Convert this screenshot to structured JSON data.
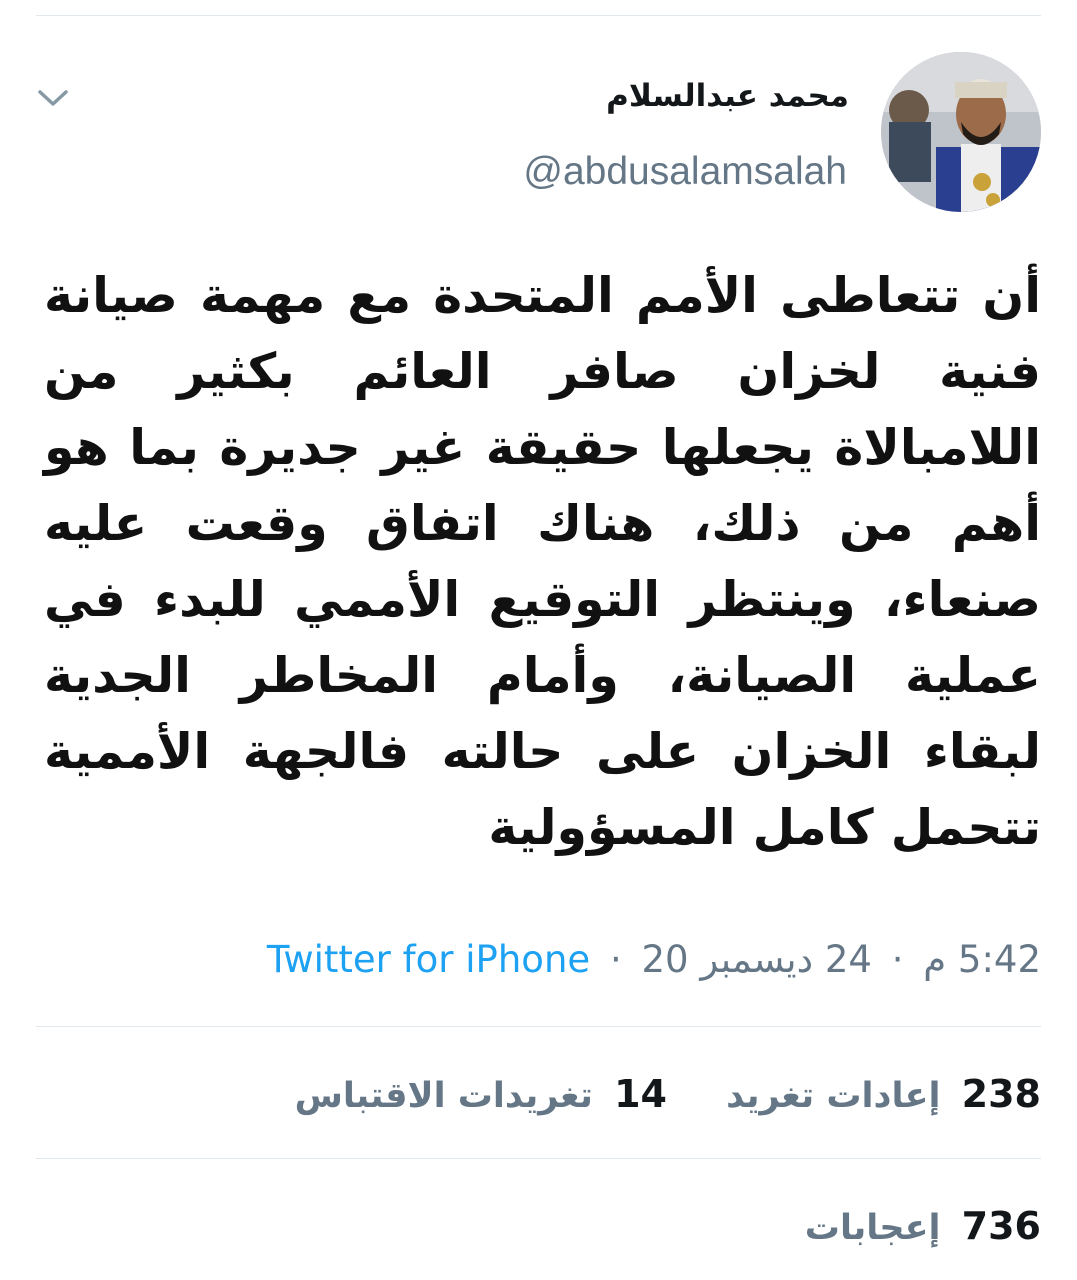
{
  "user": {
    "display_name": "محمد عبدالسلام",
    "handle": "@abdusalamsalah"
  },
  "tweet": {
    "text": "أن تتعاطى الأمم المتحدة مع مهمة صيانة فنية لخزان صافر العائم بكثير من اللامبالاة يجعلها حقيقة غير جديرة بما هو أهم من ذلك، هناك اتفاق وقعت عليه صنعاء، وينتظر التوقيع الأممي للبدء في عملية الصيانة، وأمام المخاطر الجدية لبقاء الخزان على حالته فالجهة الأممية تتحمل كامل المسؤولية"
  },
  "meta": {
    "time": "5:42 م",
    "separator": "·",
    "date": "24 ديسمبر 20",
    "source": "Twitter for iPhone"
  },
  "stats": {
    "retweets_count": "238",
    "retweets_label": "إعادات تغريد",
    "quotes_count": "14",
    "quotes_label": "تغريدات الاقتباس",
    "likes_count": "736",
    "likes_label": "إعجابات"
  },
  "colors": {
    "text": "#14171a",
    "secondary": "#657786",
    "link": "#1da1f2",
    "divider": "#e1e8ed"
  }
}
